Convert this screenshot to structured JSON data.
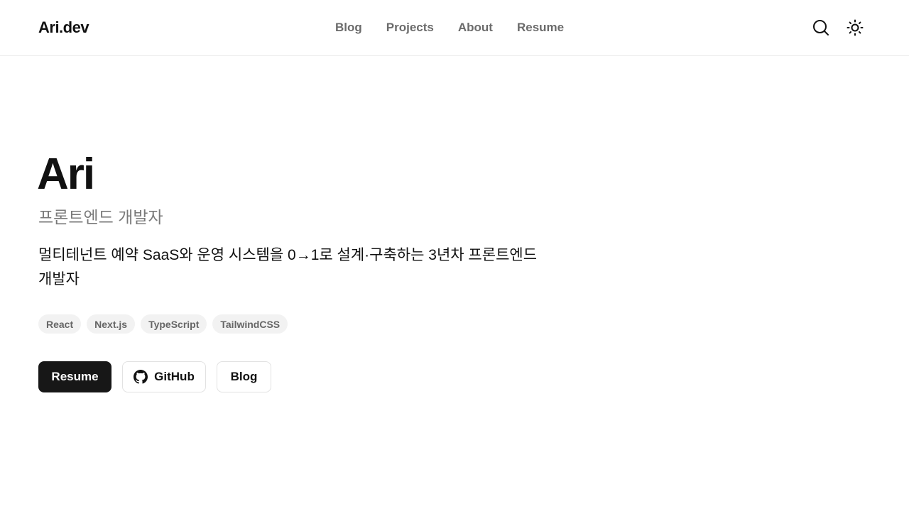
{
  "header": {
    "logo": "Ari.dev",
    "nav": [
      {
        "label": "Blog"
      },
      {
        "label": "Projects"
      },
      {
        "label": "About"
      },
      {
        "label": "Resume"
      }
    ],
    "icons": [
      "search-icon",
      "sun-icon"
    ]
  },
  "hero": {
    "name": "Ari",
    "role": "프론트엔드 개발자",
    "description": "멀티테넌트 예약 SaaS와 운영 시스템을 0→1로 설계·구축하는 3년차 프론트엔드 개발자",
    "tags": [
      "React",
      "Next.js",
      "TypeScript",
      "TailwindCSS"
    ],
    "buttons": {
      "resume": "Resume",
      "github": "GitHub",
      "blog": "Blog"
    }
  },
  "colors": {
    "primary_button": "#171717",
    "muted_text": "#7a7a7a",
    "tag_background": "#f2f2f2"
  }
}
